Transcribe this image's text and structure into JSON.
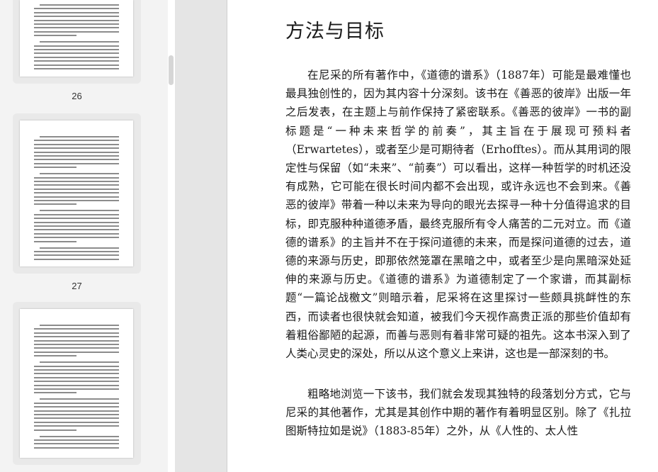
{
  "sidebar": {
    "thumbnails": [
      {
        "page_label": "26"
      },
      {
        "page_label": "27"
      },
      {
        "page_label": ""
      }
    ]
  },
  "document": {
    "title": "方法与目标",
    "paragraphs": [
      "在尼采的所有著作中，《道德的谱系》（1887年）可能是最难懂也最具独创性的，因为其内容十分深刻。该书在《善恶的彼岸》出版一年之后发表，在主题上与前作保持了紧密联系。《善恶的彼岸》一书的副标题是“一种未来哲学的前奏”，其主旨在于展现可预料者（Erwartetes），或者至少是可期待者（Erhofftes）。而从其用词的限定性与保留（如“未来”、“前奏”）可以看出，这样一种哲学的时机还没有成熟，它可能在很长时间内都不会出现，或许永远也不会到来。《善恶的彼岸》带着一种以未来为导向的眼光去探寻一种十分值得追求的目标，即克服种种道德矛盾，最终克服所有令人痛苦的二元对立。而《道德的谱系》的主旨并不在于探问道德的未来，而是探问道德的过去，道德的来源与历史，即那依然笼罩在黑暗之中，或者至少是向黑暗深处延伸的来源与历史。《道德的谱系》为道德制定了一个家谱，而其副标题“一篇论战檄文”则暗示着，尼采将在这里探讨一些颇具挑衅性的东西，而读者也很快就会知道，被我们今天视作高贵正派的那些价值却有着粗俗鄙陋的起源，而善与恶则有着非常可疑的祖先。这本书深入到了人类心灵史的深处，所以从这个意义上来讲，这也是一部深刻的书。",
      "粗略地浏览一下该书，我们就会发现其独特的段落划分方式，它与尼采的其他著作，尤其是其创作中期的著作有着明显区别。除了《扎拉图斯特拉如是说》（1883-85年）之外，从《人性的、太人性"
    ]
  }
}
